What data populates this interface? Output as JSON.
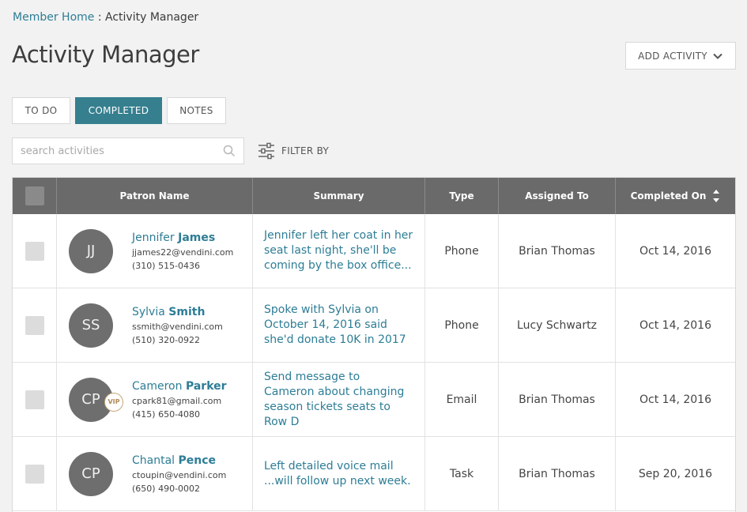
{
  "breadcrumb": {
    "home": "Member Home",
    "separator": " : ",
    "current": "Activity Manager"
  },
  "page_title": "Activity Manager",
  "add_activity_label": "ADD ACTIVITY",
  "tabs": [
    {
      "label": "TO DO",
      "active": false
    },
    {
      "label": "COMPLETED",
      "active": true
    },
    {
      "label": "NOTES",
      "active": false
    }
  ],
  "search": {
    "placeholder": "search activities",
    "value": ""
  },
  "filter_label": "FILTER BY",
  "table": {
    "headers": {
      "patron": "Patron Name",
      "summary": "Summary",
      "type": "Type",
      "assigned": "Assigned To",
      "completed": "Completed On"
    },
    "rows": [
      {
        "initials": "JJ",
        "first": "Jennifer",
        "last": "James",
        "email": "jjames22@vendini.com",
        "phone": "(310) 515-0436",
        "summary": "Jennifer left her coat in her seat last night, she'll be coming by the box office...",
        "type": "Phone",
        "assigned": "Brian Thomas",
        "completed": "Oct 14, 2016",
        "vip": false
      },
      {
        "initials": "SS",
        "first": "Sylvia",
        "last": "Smith",
        "email": "ssmith@vendini.com",
        "phone": "(510) 320-0922",
        "summary": "Spoke with Sylvia on October 14, 2016 said she'd donate 10K in 2017",
        "type": "Phone",
        "assigned": "Lucy Schwartz",
        "completed": "Oct 14, 2016",
        "vip": false
      },
      {
        "initials": "CP",
        "first": "Cameron",
        "last": "Parker",
        "email": "cpark81@gmail.com",
        "phone": "(415) 650-4080",
        "summary": "Send message to Cameron about changing season tickets seats to Row D",
        "type": "Email",
        "assigned": "Brian Thomas",
        "completed": "Oct 14, 2016",
        "vip": true,
        "vip_label": "VIP"
      },
      {
        "initials": "CP",
        "first": "Chantal",
        "last": "Pence",
        "email": "ctoupin@vendini.com",
        "phone": "(650) 490-0002",
        "summary": "Left detailed voice mail ...will follow up next week.",
        "type": "Task",
        "assigned": "Brian Thomas",
        "completed": "Sep 20, 2016",
        "vip": false
      }
    ]
  },
  "icons": {
    "dropdown": "chevron-down-icon",
    "search": "search-icon",
    "filter": "sliders-icon",
    "sort": "sort-icon"
  },
  "colors": {
    "accent": "#2d7d96",
    "active_tab": "#357f8f",
    "header_bg": "#6a6a6a",
    "background": "#f2f2f2"
  }
}
